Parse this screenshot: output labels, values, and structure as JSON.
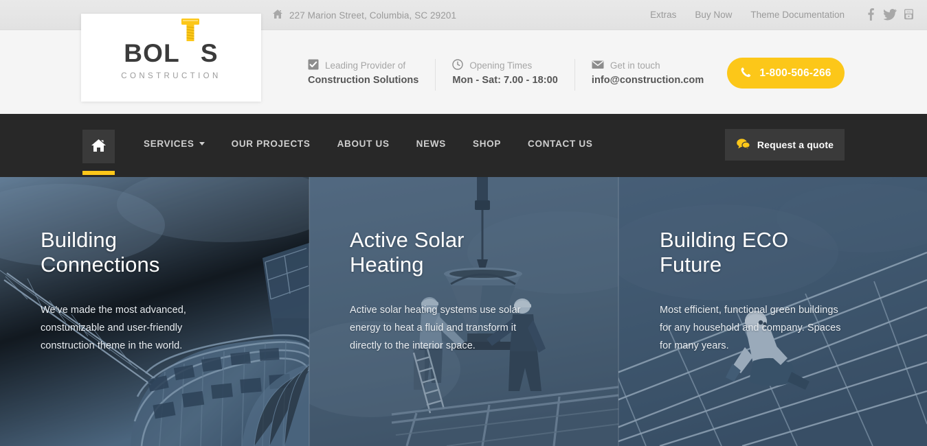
{
  "topbar": {
    "address_icon": "home-icon",
    "address": "227 Marion Street, Columbia, SC 29201",
    "links": [
      {
        "label": "Extras"
      },
      {
        "label": "Buy Now"
      },
      {
        "label": "Theme Documentation"
      }
    ],
    "social": [
      {
        "name": "facebook-icon"
      },
      {
        "name": "twitter-icon"
      },
      {
        "name": "youtube-icon"
      }
    ]
  },
  "logo": {
    "word_before": "BOL",
    "word_after": "S",
    "bolt_icon": "bolt-screw-icon",
    "subtitle": "CONSTRUCTION"
  },
  "info": {
    "blocks": [
      {
        "icon": "check-square-icon",
        "top": "Leading Provider of",
        "bottom": "Construction Solutions"
      },
      {
        "icon": "clock-icon",
        "top": "Opening Times",
        "bottom": "Mon - Sat: 7.00 - 18:00"
      },
      {
        "icon": "envelope-icon",
        "top": "Get in touch",
        "bottom": "info@construction.com"
      }
    ],
    "phone_button": {
      "icon": "phone-icon",
      "number": "1-800-506-266"
    }
  },
  "nav": {
    "home_icon": "home-icon",
    "items": [
      {
        "label": "SERVICES",
        "has_dropdown": true
      },
      {
        "label": "OUR PROJECTS",
        "has_dropdown": false
      },
      {
        "label": "ABOUT US",
        "has_dropdown": false
      },
      {
        "label": "NEWS",
        "has_dropdown": false
      },
      {
        "label": "SHOP",
        "has_dropdown": false
      },
      {
        "label": "CONTACT US",
        "has_dropdown": false
      }
    ],
    "quote_button": {
      "icon": "speech-bubble-icon",
      "label": "Request a quote"
    }
  },
  "hero": {
    "panels": [
      {
        "title": "Building Connections",
        "description": "We've made the most advanced, constumizable and user-friendly construction theme in the world.",
        "image": "construction-building-with-crane"
      },
      {
        "title": "Active Solar Heating",
        "description": "Active solar heating systems use solar energy to heat a fluid and transform it directly to the interior space.",
        "image": "workers-with-concrete-bucket"
      },
      {
        "title": "Building ECO Future",
        "description": "Most efficient, functional green buildings for any household and company. Spaces for many years.",
        "image": "solar-panel-installer"
      }
    ]
  },
  "colors": {
    "accent_yellow": "#fcc719",
    "nav_dark": "#282828",
    "topbar_gray": "#e6e6e6",
    "midbar_gray": "#f5f5f5",
    "hero_blue": "#55708b"
  }
}
